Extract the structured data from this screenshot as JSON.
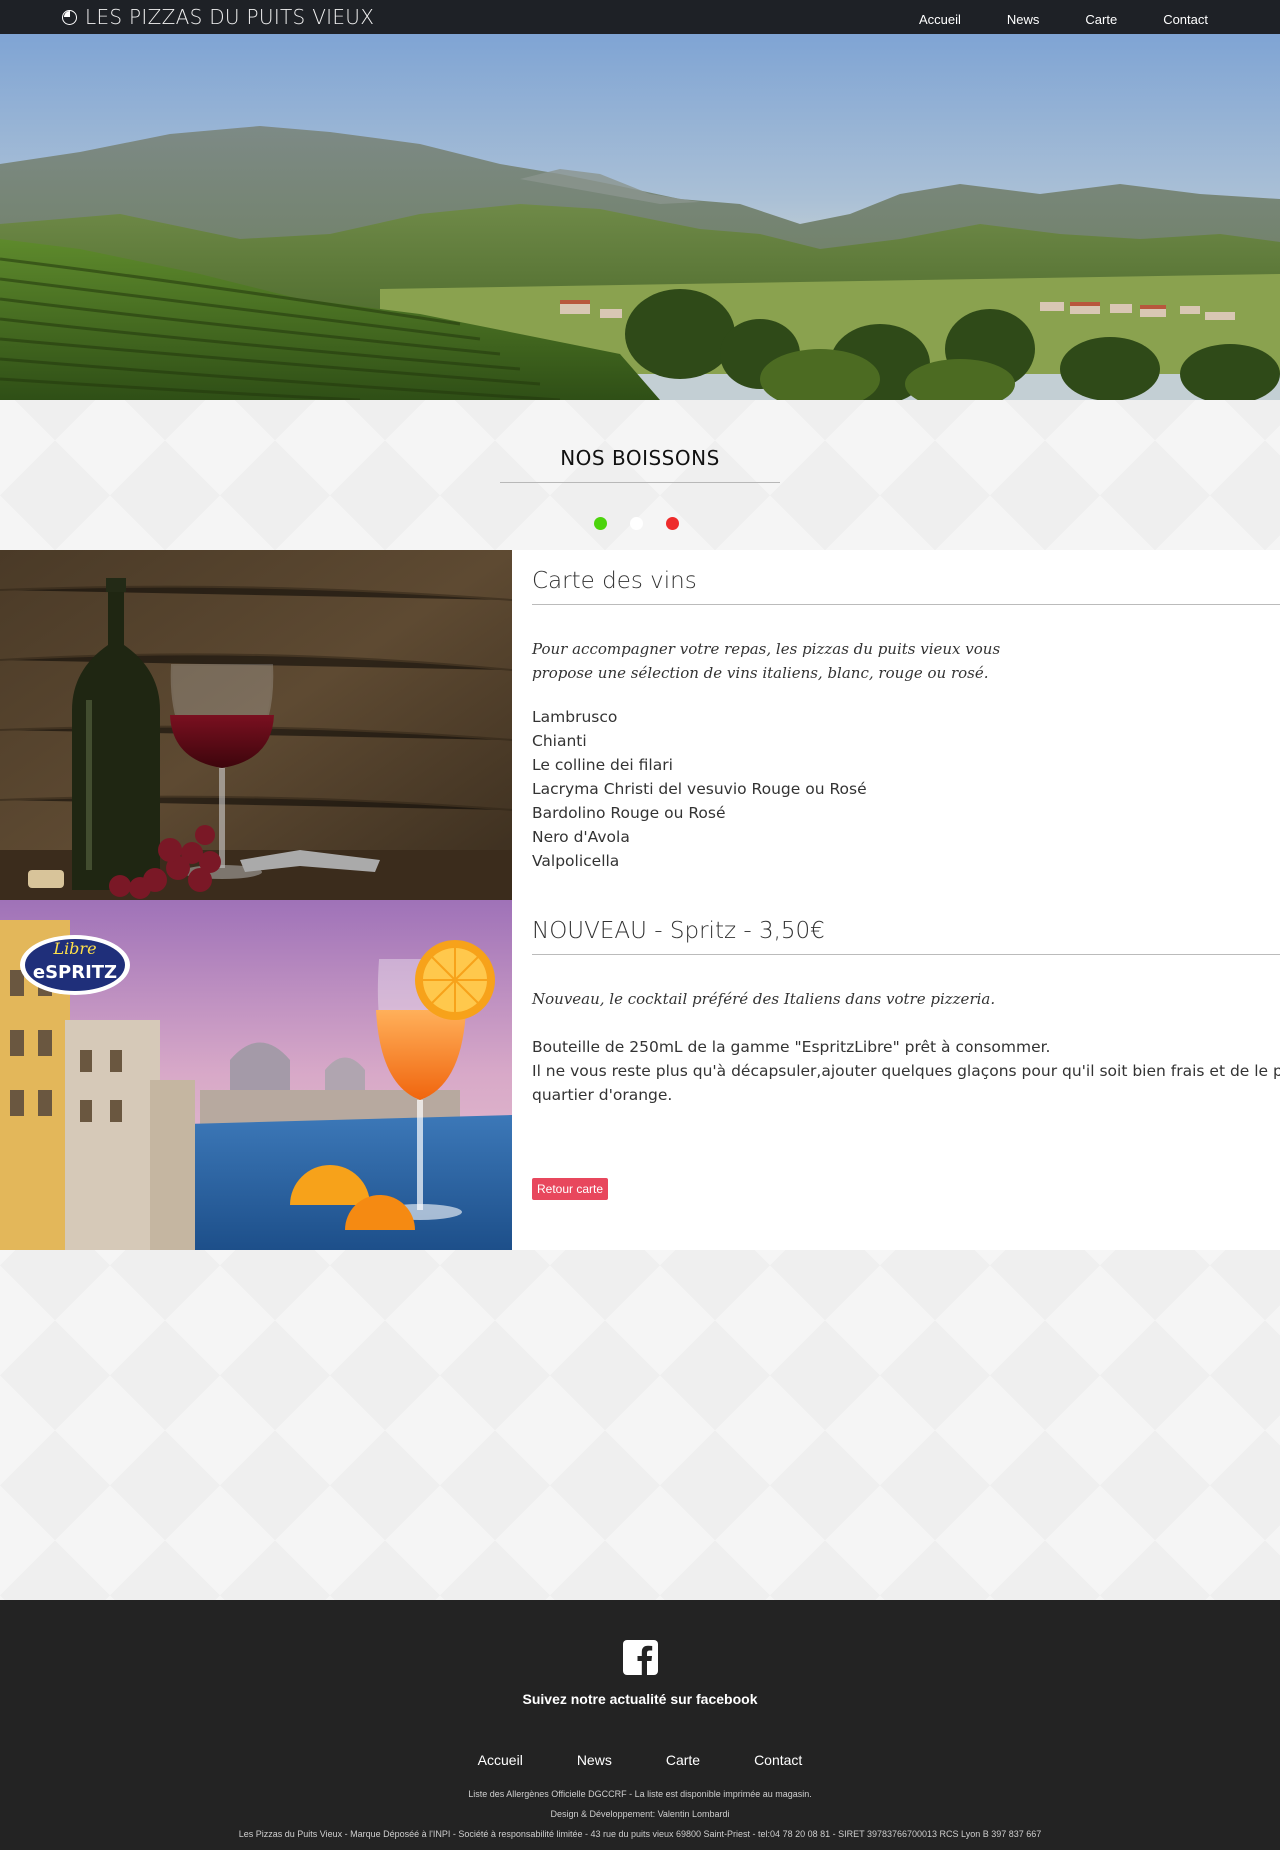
{
  "nav": {
    "brand": "LES PIZZAS DU PUITS VIEUX",
    "links": [
      "Accueil",
      "News",
      "Carte",
      "Contact"
    ]
  },
  "section": {
    "title": "NOS BOISSONS",
    "dot_colors": [
      "#4cd40c",
      "#ffffff",
      "#ee2b2b"
    ]
  },
  "wine": {
    "title": "Carte des vins",
    "intro": "Pour accompagner votre repas, les pizzas du puits vieux vous propose une sélection de vins italiens, blanc, rouge ou rosé.",
    "items": [
      "Lambrusco",
      "Chianti",
      "Le colline dei filari",
      "Lacryma Christi del vesuvio Rouge ou Rosé",
      "Bardolino Rouge ou Rosé",
      "Nero d'Avola",
      "Valpolicella"
    ]
  },
  "spritz": {
    "title": "NOUVEAU - Spritz - 3,50€",
    "intro": "Nouveau, le cocktail préféré des Italiens dans votre pizzeria.",
    "body_line1": "Bouteille de 250mL de la gamme \"EspritzLibre\" prêt à consommer.",
    "body_line2": "Il ne vous reste plus qu'à décapsuler,ajouter quelques glaçons pour qu'il soit bien frais et de le perfecti",
    "body_line3": "quartier d'orange.",
    "logo_text_script": "Libre",
    "logo_text_main": "eSPRITZ",
    "back_button": "Retour carte"
  },
  "footer": {
    "facebook_label": "Suivez notre actualité sur facebook",
    "links": [
      "Accueil",
      "News",
      "Carte",
      "Contact"
    ],
    "line1": "Liste des Allergènes Officielle DGCCRF - La liste est disponible imprimée au magasin.",
    "line2": "Design & Développement: Valentin Lombardi",
    "line3": "Les Pizzas du Puits Vieux - Marque Déposéé à l'INPI - Société à responsabilité limitée - 43 rue du puits vieux 69800 Saint-Priest - tel:04 78 20 08 81 - SIRET 39783766700013 RCS Lyon B 397 837 667"
  }
}
